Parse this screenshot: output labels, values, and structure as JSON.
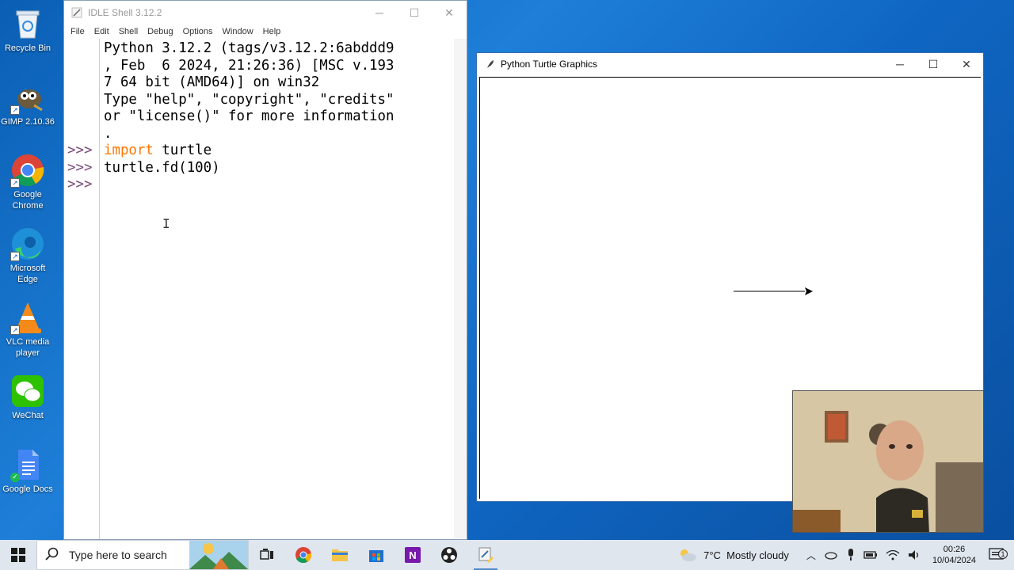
{
  "desktop": {
    "icons": [
      {
        "label": "Recycle Bin",
        "icon": "recycle-bin-icon"
      },
      {
        "label": "GIMP 2.10.36",
        "icon": "gimp-icon"
      },
      {
        "label": "Google Chrome",
        "icon": "chrome-icon"
      },
      {
        "label": "Microsoft Edge",
        "icon": "edge-icon"
      },
      {
        "label": "VLC media player",
        "icon": "vlc-icon"
      },
      {
        "label": "WeChat",
        "icon": "wechat-icon"
      },
      {
        "label": "Google Docs",
        "icon": "google-docs-icon"
      }
    ]
  },
  "idle": {
    "title": "IDLE Shell 3.12.2",
    "menu": [
      "File",
      "Edit",
      "Shell",
      "Debug",
      "Options",
      "Window",
      "Help"
    ],
    "banner_lines": [
      "Python 3.12.2 (tags/v3.12.2:6abddd9",
      ", Feb  6 2024, 21:26:36) [MSC v.193",
      "7 64 bit (AMD64)] on win32",
      "Type \"help\", \"copyright\", \"credits\"",
      "or \"license()\" for more information",
      "."
    ],
    "prompt": ">>>",
    "line1_keyword": "import",
    "line1_rest": " turtle",
    "line2": "turtle.fd(100)",
    "line3": ""
  },
  "turtle_window": {
    "title": "Python Turtle Graphics",
    "line_length": 100
  },
  "taskbar": {
    "search_placeholder": "Type here to search",
    "weather": "7°C  Mostly cloudy",
    "time": "00:26",
    "date": "10/04/2024",
    "notification_count": "1"
  },
  "colors": {
    "keyword": "#ff7700",
    "prompt": "#7a4b7a",
    "desktop": "#0f66c2"
  }
}
